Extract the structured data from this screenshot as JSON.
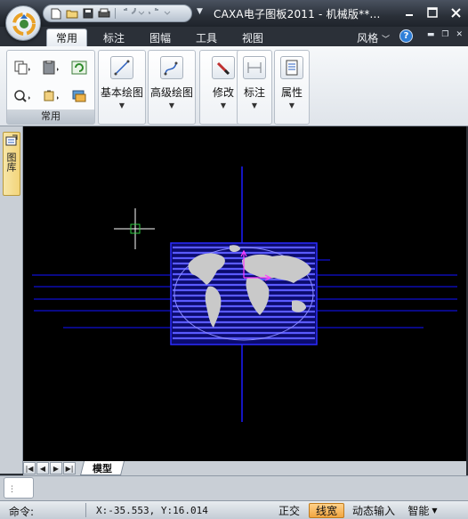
{
  "window": {
    "title": "CAXA电子图板2011 - 机械版**...",
    "controls": [
      "minimize-icon",
      "maximize-icon",
      "close-icon"
    ]
  },
  "quick_access": {
    "icons": [
      "new-file-icon",
      "open-folder-icon",
      "save-icon",
      "print-icon",
      "undo-icon",
      "redo-icon"
    ]
  },
  "ribbon_tabs": [
    {
      "label": "常用",
      "active": true
    },
    {
      "label": "标注",
      "active": false
    },
    {
      "label": "图幅",
      "active": false
    },
    {
      "label": "工具",
      "active": false
    },
    {
      "label": "视图",
      "active": false
    }
  ],
  "ribbon_right": {
    "style_label": "风格",
    "help": "?"
  },
  "ribbon": {
    "common_group_label": "常用",
    "big_buttons": [
      {
        "label": "基本绘图",
        "icon": "line-draw-icon"
      },
      {
        "label": "高级绘图",
        "icon": "curve-draw-icon"
      },
      {
        "label": "修改",
        "icon": "eraser-icon"
      },
      {
        "label": "标注",
        "icon": "dimension-icon"
      },
      {
        "label": "属性",
        "icon": "properties-icon"
      }
    ]
  },
  "side_panel": {
    "tab_label": "图库"
  },
  "layout_tabs": {
    "active": "模型"
  },
  "command": {
    "prompt": "命令:"
  },
  "status": {
    "coords": "X:-35.553, Y:16.014",
    "toggles": [
      {
        "label": "正交",
        "on": false
      },
      {
        "label": "线宽",
        "on": true
      },
      {
        "label": "动态输入",
        "on": false
      },
      {
        "label": "智能",
        "on": false
      }
    ]
  },
  "colors": {
    "canvas": "#000000",
    "axis": "#1c1cff",
    "map_fill": "#c9c9c9",
    "cursor": "#ffffff",
    "ucs": "#ff3cff",
    "active_toggle": "#f1a640"
  }
}
